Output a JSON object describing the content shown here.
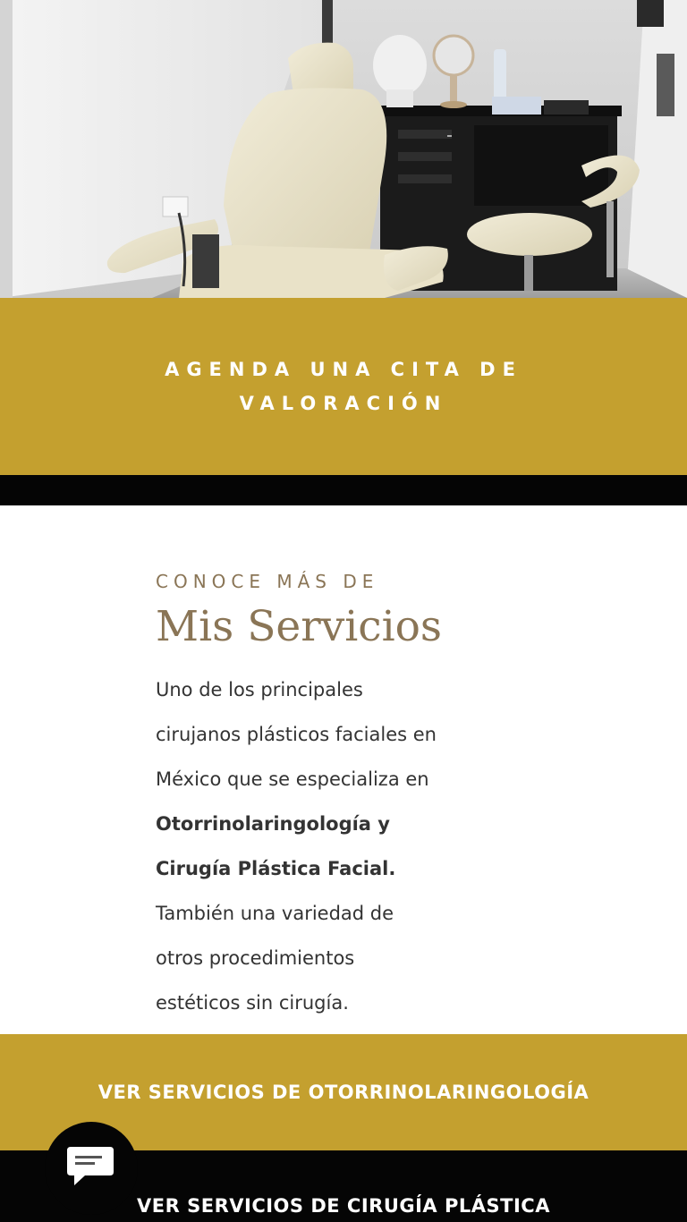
{
  "colors": {
    "gold": "#c4a02f",
    "black": "#050505",
    "heading_brown": "#8a7556",
    "body_text": "#333333",
    "white": "#ffffff"
  },
  "hero": {
    "description_icon": "clinic-exam-chair-photo"
  },
  "appointment_cta": {
    "label": "AGENDA UNA CITA DE VALORACIÓN"
  },
  "services": {
    "eyebrow": "CONOCE MÁS DE",
    "title": "Mis Servicios",
    "body_lines": [
      "Uno de los principales",
      "cirujanos plásticos faciales en",
      "México que se especializa en",
      "Otorrinolaringología y",
      "Cirugía Plástica Facial.",
      "También una variedad de",
      "otros procedimientos",
      "estéticos sin cirugía."
    ]
  },
  "buttons": {
    "otorrino_label": "VER SERVICIOS DE OTORRINOLARINGOLOGÍA",
    "cirugia_label": "VER SERVICIOS DE CIRUGÍA PLÁSTICA"
  },
  "chat": {
    "icon": "chat-bubble-icon"
  }
}
